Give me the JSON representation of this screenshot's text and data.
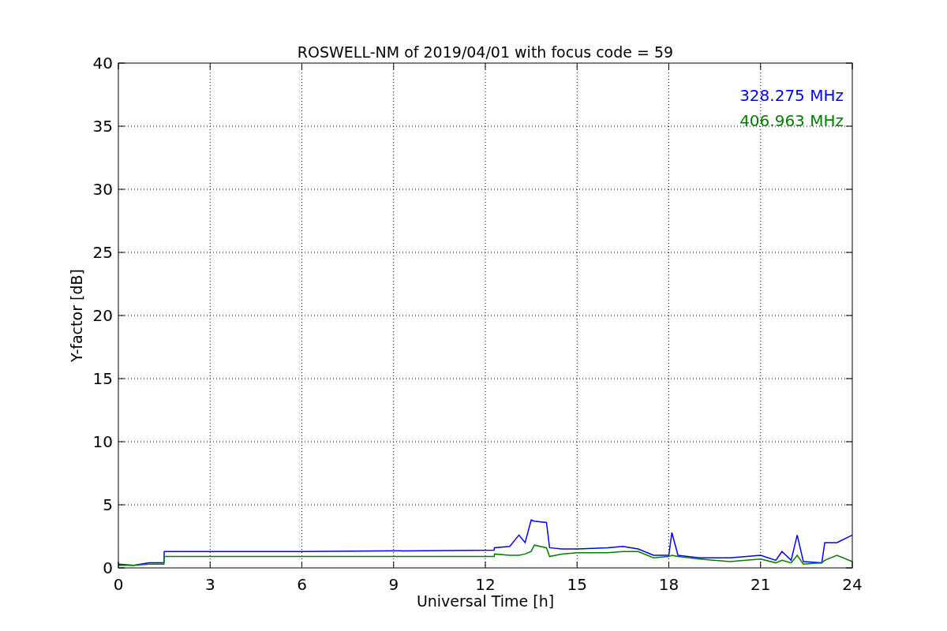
{
  "chart_data": {
    "type": "line",
    "title": "ROSWELL-NM of 2019/04/01 with focus code = 59",
    "xlabel": "Universal Time [h]",
    "ylabel": "Y-factor [dB]",
    "x": [
      0,
      0.5,
      1,
      1.49,
      1.5,
      6,
      12.29,
      12.3,
      12.8,
      13.1,
      13.3,
      13.5,
      13.6,
      14,
      14.1,
      14.5,
      15,
      16,
      16.5,
      17,
      17.5,
      18,
      18.1,
      18.3,
      19,
      20,
      21,
      21.5,
      21.7,
      22,
      22.2,
      22.4,
      23,
      23.1,
      23.5,
      24
    ],
    "series": [
      {
        "name": "328.275 MHz",
        "color": "#0000ff",
        "values": [
          0.3,
          0.2,
          0.4,
          0.4,
          1.3,
          1.3,
          1.4,
          1.6,
          1.7,
          2.6,
          2.0,
          3.8,
          3.7,
          3.6,
          1.6,
          1.5,
          1.5,
          1.6,
          1.7,
          1.5,
          1.0,
          1.0,
          2.8,
          1.0,
          0.8,
          0.8,
          1.0,
          0.6,
          1.3,
          0.6,
          2.6,
          0.5,
          0.4,
          2.0,
          2.0,
          2.6
        ]
      },
      {
        "name": "406.963 MHz",
        "color": "#008000",
        "values": [
          0.2,
          0.2,
          0.3,
          0.3,
          0.9,
          0.9,
          0.9,
          1.1,
          1.0,
          1.0,
          1.1,
          1.3,
          1.8,
          1.6,
          0.9,
          1.1,
          1.2,
          1.2,
          1.3,
          1.3,
          0.8,
          0.9,
          1.0,
          0.9,
          0.7,
          0.5,
          0.7,
          0.4,
          0.6,
          0.4,
          1.0,
          0.3,
          0.4,
          0.6,
          1.0,
          0.5
        ]
      }
    ],
    "xlim": [
      0,
      24
    ],
    "ylim": [
      0,
      40
    ],
    "xticks": [
      0,
      3,
      6,
      9,
      12,
      15,
      18,
      21,
      24
    ],
    "yticks": [
      0,
      5,
      10,
      15,
      20,
      25,
      30,
      35,
      40
    ],
    "grid": true
  }
}
